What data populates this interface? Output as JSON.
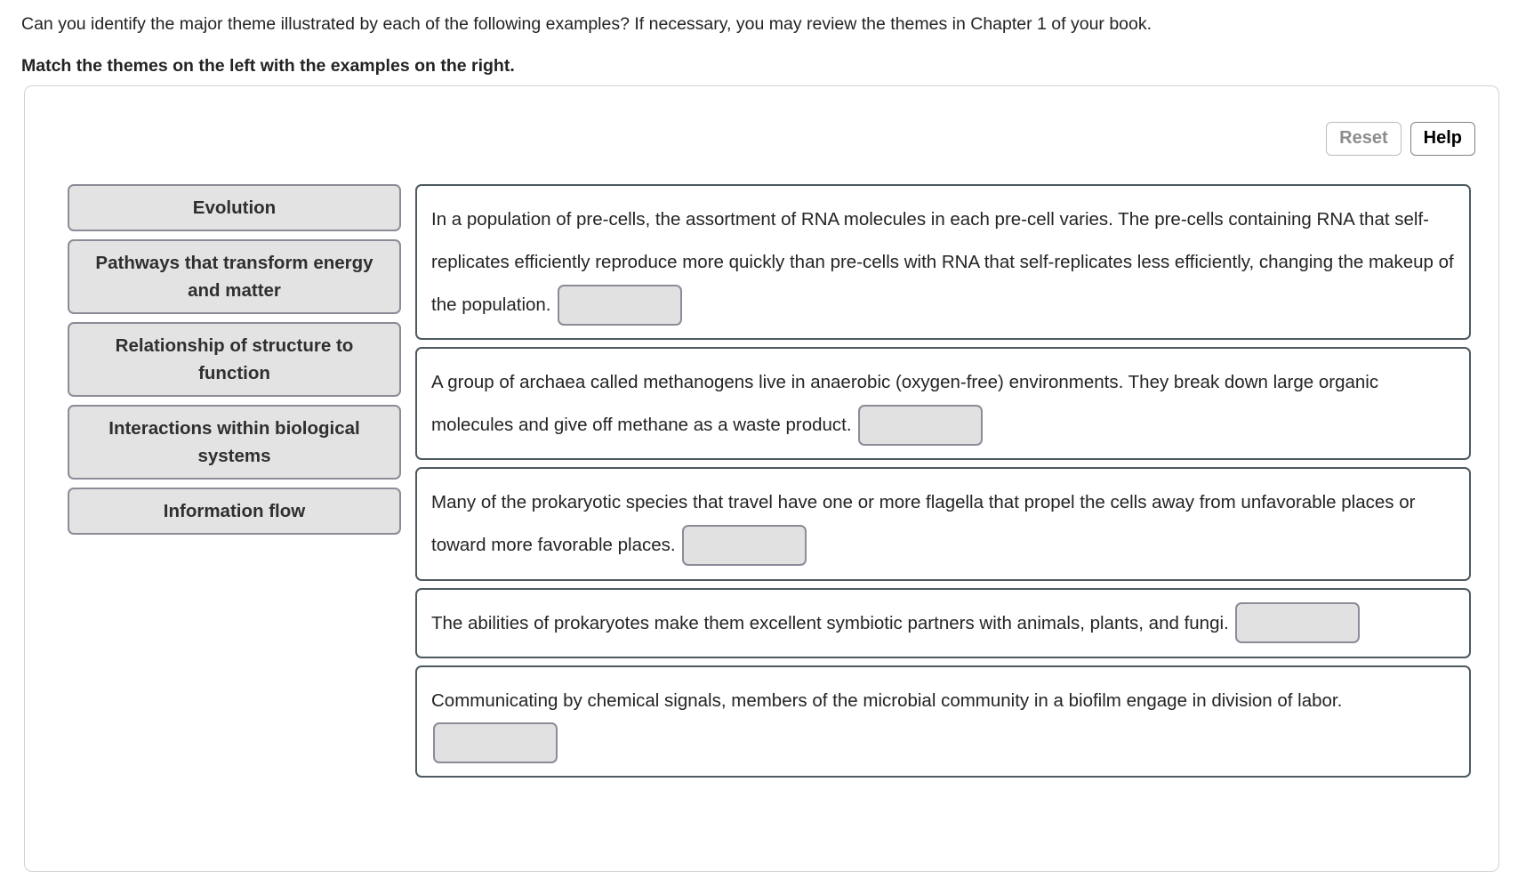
{
  "prompt": {
    "question": "Can you identify the major theme illustrated by each of the following examples? If necessary, you may review the themes in Chapter 1 of your book.",
    "instruction": "Match the themes on the left with the examples on the right."
  },
  "toolbar": {
    "reset_label": "Reset",
    "help_label": "Help"
  },
  "themes": [
    {
      "label": "Evolution"
    },
    {
      "label": "Pathways that transform energy and matter"
    },
    {
      "label": "Relationship of structure to function"
    },
    {
      "label": "Interactions within biological systems"
    },
    {
      "label": "Information flow"
    }
  ],
  "examples": [
    {
      "text": "In a population of pre-cells, the assortment of RNA molecules in each pre-cell varies. The pre-cells containing RNA that self-replicates efficiently reproduce more quickly than pre-cells with RNA that self-replicates less efficiently, changing the makeup of the population.",
      "answer": ""
    },
    {
      "text": "A group of archaea called methanogens live in anaerobic (oxygen-free) environments. They break down large organic molecules and give off methane as a waste product.",
      "answer": ""
    },
    {
      "text": "Many of the prokaryotic species that travel have one or more flagella that propel the cells away from unfavorable places or toward more favorable places.",
      "answer": ""
    },
    {
      "text": "The abilities of prokaryotes make them excellent symbiotic partners with animals, plants, and fungi.",
      "answer": ""
    },
    {
      "text": "Communicating by chemical signals, members of the microbial community in a biofilm engage in division of labor.",
      "answer": ""
    }
  ],
  "colors": {
    "tile_fill": "#e3e3e3",
    "tile_border": "#8c8c99",
    "card_border": "#4d5a60",
    "panel_border": "#d3d3d6",
    "reset_text": "#8d8d8d",
    "help_text": "#000000"
  }
}
